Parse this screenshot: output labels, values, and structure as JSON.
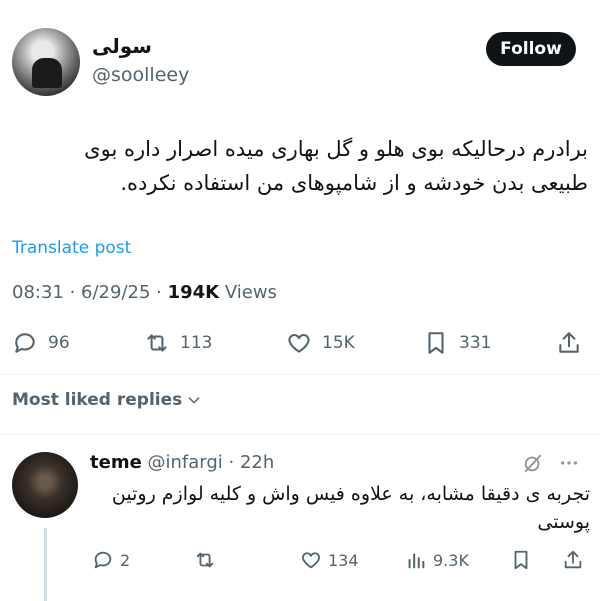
{
  "author": {
    "display_name": "سولی",
    "handle": "@soolleey",
    "follow_label": "Follow"
  },
  "tweet": {
    "text": "برادرم درحالیکه بوی هلو و گل بهاری میده اصرار داره بوی طبیعی بدن خودشه و از شامپوهای من استفاده نکرده.",
    "translate_label": "Translate post",
    "time": "08:31 · 6/29/25 · ",
    "views_count": "194K",
    "views_label": " Views"
  },
  "actions": {
    "replies": "96",
    "reposts": "113",
    "likes": "15K",
    "bookmarks": "331"
  },
  "replies_section": {
    "sort_label": "Most liked replies"
  },
  "reply": {
    "name": "teme",
    "handle": "@infargi",
    "time": "22h",
    "text": "تجربه ی دقیقا مشابه، به علاوه فیس واش و کلیه لوازم روتین پوستی",
    "replies": "2",
    "likes": "134",
    "views": "9.3K"
  },
  "colors": {
    "accent": "#1d9bf0",
    "text": "#0f1419",
    "muted": "#536471"
  },
  "icons": [
    "reply-icon",
    "repost-icon",
    "like-icon",
    "bookmark-icon",
    "share-icon",
    "views-icon",
    "grok-icon",
    "more-icon",
    "chevron-down-icon"
  ]
}
